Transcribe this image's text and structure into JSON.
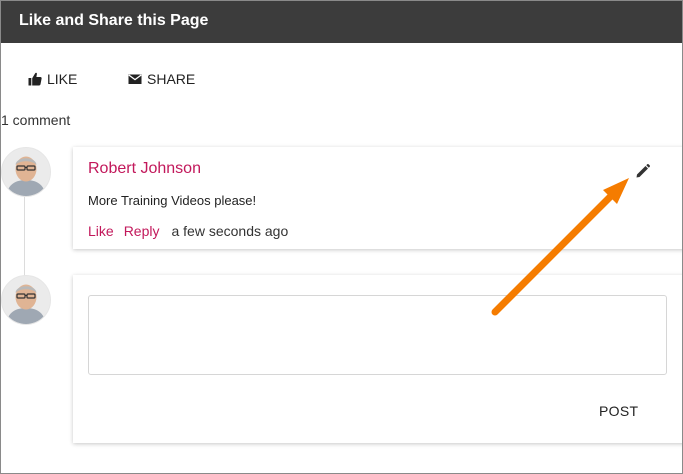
{
  "header": {
    "title": "Like and Share this Page"
  },
  "actions": {
    "like_label": "LIKE",
    "like_icon": "thumbs-up-icon",
    "share_label": "SHARE",
    "share_icon": "envelope-icon"
  },
  "comments": {
    "count_label": "1 comment",
    "items": [
      {
        "author": "Robert Johnson",
        "text": "More Training Videos please!",
        "like_label": "Like",
        "reply_label": "Reply",
        "time": "a few seconds ago",
        "edit_icon": "pencil-icon"
      }
    ]
  },
  "reply": {
    "value": "",
    "post_label": "POST"
  },
  "colors": {
    "header_bg": "#3c3c3c",
    "accent": "#c2185b",
    "annotation_arrow": "#f57c00"
  }
}
